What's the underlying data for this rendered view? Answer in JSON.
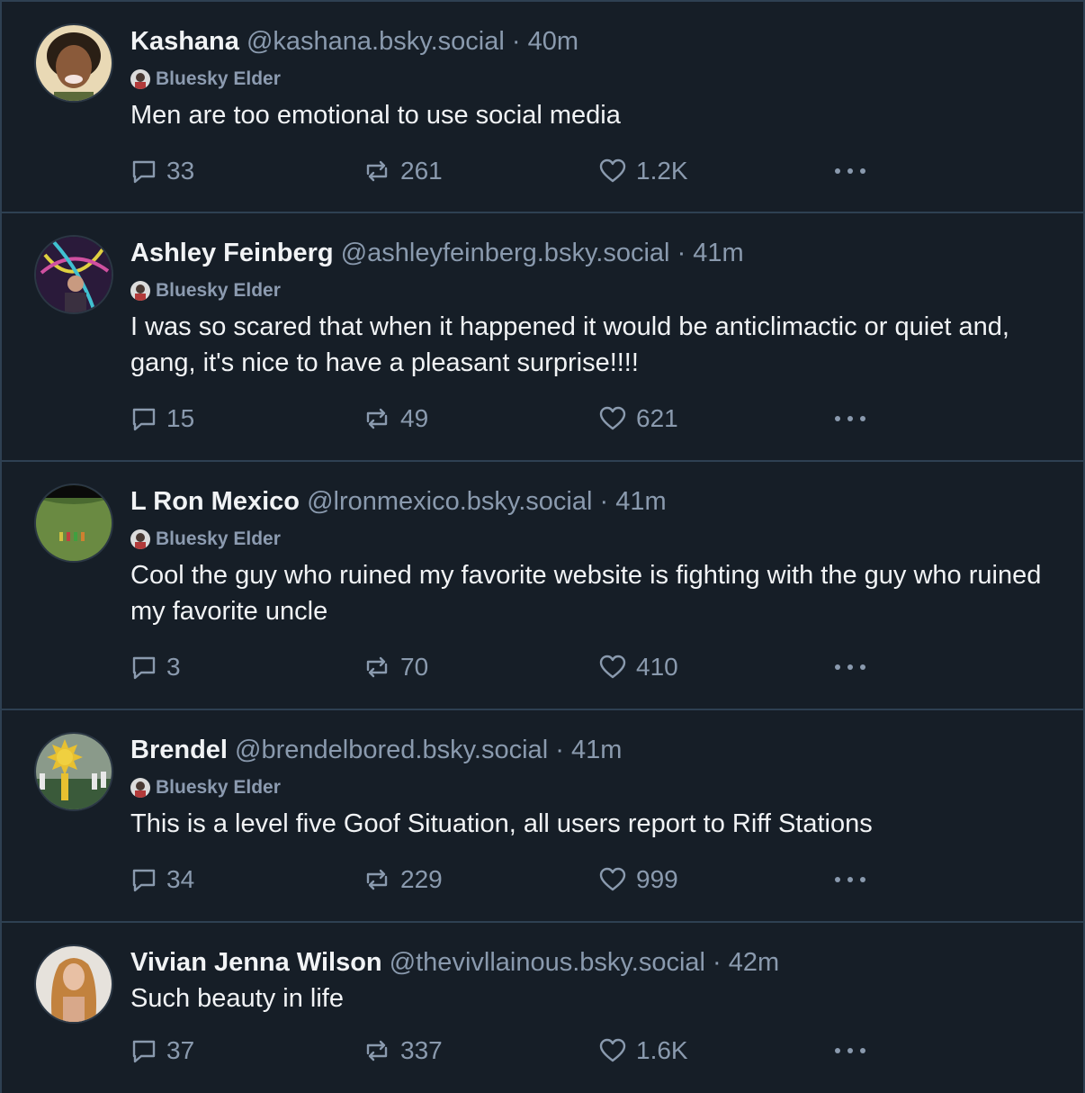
{
  "feed": {
    "posts": [
      {
        "name": "Kashana",
        "handle": "@kashana.bsky.social",
        "time": "40m",
        "badge": "Bluesky Elder",
        "text": "Men are too emotional to use social media",
        "replies": "33",
        "reposts": "261",
        "likes": "1.2K"
      },
      {
        "name": "Ashley Feinberg",
        "handle": "@ashleyfeinberg.bsky.social",
        "time": "41m",
        "badge": "Bluesky Elder",
        "text": "I was so scared that when it happened it would be anticlimactic or quiet and, gang, it's nice to have a pleasant surprise!!!!",
        "replies": "15",
        "reposts": "49",
        "likes": "621"
      },
      {
        "name": "L Ron Mexico",
        "handle": "@lronmexico.bsky.social",
        "time": "41m",
        "badge": "Bluesky Elder",
        "text": "Cool the guy who ruined my favorite website is fighting with the guy who ruined my favorite uncle",
        "replies": "3",
        "reposts": "70",
        "likes": "410"
      },
      {
        "name": "Brendel",
        "handle": "@brendelbored.bsky.social",
        "time": "41m",
        "badge": "Bluesky Elder",
        "text": "This is a level five Goof Situation, all users report to Riff Stations",
        "replies": "34",
        "reposts": "229",
        "likes": "999"
      },
      {
        "name": "Vivian Jenna Wilson",
        "handle": "@thevivllainous.bsky.social",
        "time": "42m",
        "text": "Such beauty in life",
        "replies": "37",
        "reposts": "337",
        "likes": "1.6K"
      }
    ]
  },
  "ui": {
    "separator": "·",
    "icons": {
      "reply": "speech-bubble-icon",
      "repost": "repost-arrows-icon",
      "like": "heart-icon",
      "more": "ellipsis-icon"
    },
    "colors": {
      "background": "#161e27",
      "divider": "#2e4052",
      "text_primary": "#f1f3f5",
      "text_secondary": "#8a9aae"
    }
  }
}
